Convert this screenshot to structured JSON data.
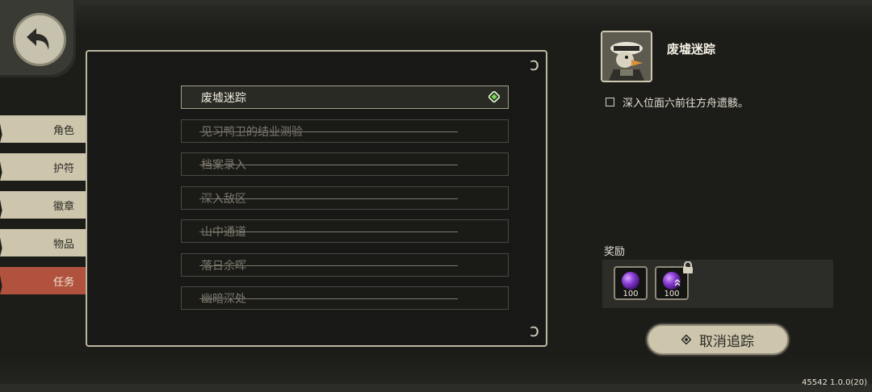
{
  "nav": {
    "back_icon": "back-arrow-icon",
    "tabs": [
      {
        "label": "角色",
        "active": false
      },
      {
        "label": "护符",
        "active": false
      },
      {
        "label": "徽章",
        "active": false
      },
      {
        "label": "物品",
        "active": false
      },
      {
        "label": "任务",
        "active": true
      }
    ]
  },
  "quests": [
    {
      "label": "废墟迷踪",
      "selected": true,
      "tracked": true,
      "completed": false
    },
    {
      "label": "见习鸭卫的结业测验",
      "selected": false,
      "completed": true
    },
    {
      "label": "档案录入",
      "selected": false,
      "completed": true
    },
    {
      "label": "深入敌区",
      "selected": false,
      "completed": true
    },
    {
      "label": "山中通道",
      "selected": false,
      "completed": true
    },
    {
      "label": "落日余晖",
      "selected": false,
      "completed": true
    },
    {
      "label": "幽暗深处",
      "selected": false,
      "completed": true
    }
  ],
  "detail": {
    "title": "废墟迷踪",
    "objective": "深入位面六前往方舟遗骸。",
    "objective_checked": false,
    "rewards_label": "奖励",
    "rewards": [
      {
        "icon": "purple-orb-icon",
        "count": "100",
        "locked": false
      },
      {
        "icon": "purple-orb-upgrade-icon",
        "count": "100",
        "locked": true
      }
    ],
    "untrack_label": "取消追踪"
  },
  "version": "45542 1.0.0(20)",
  "colors": {
    "accent_active_tab": "#b0523e",
    "tab": "#cdc6ad",
    "track_green": "#7ed957"
  }
}
